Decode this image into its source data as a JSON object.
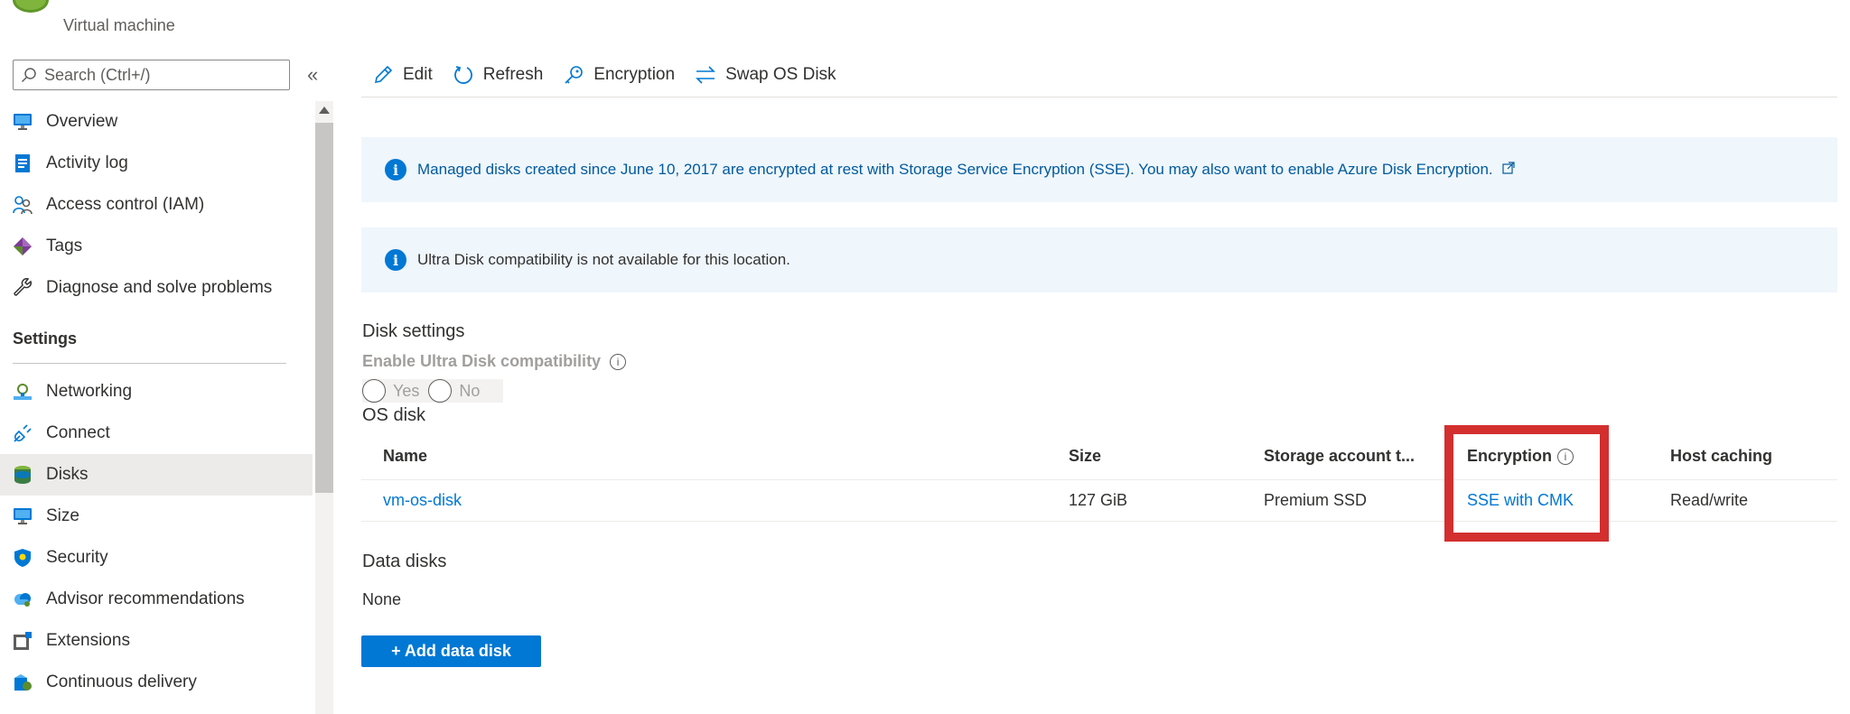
{
  "header": {
    "subtitle": "Virtual machine"
  },
  "search": {
    "placeholder": "Search (Ctrl+/)"
  },
  "sidebar": {
    "collapse_label": "«",
    "items_top": [
      {
        "label": "Overview",
        "icon": "monitor-icon"
      },
      {
        "label": "Activity log",
        "icon": "activity-log-icon"
      },
      {
        "label": "Access control (IAM)",
        "icon": "people-icon"
      },
      {
        "label": "Tags",
        "icon": "tag-icon"
      },
      {
        "label": "Diagnose and solve problems",
        "icon": "wrench-icon"
      }
    ],
    "settings_heading": "Settings",
    "items_settings": [
      {
        "label": "Networking",
        "icon": "network-icon"
      },
      {
        "label": "Connect",
        "icon": "connect-plug-icon"
      },
      {
        "label": "Disks",
        "icon": "disks-icon",
        "active": true
      },
      {
        "label": "Size",
        "icon": "monitor-icon"
      },
      {
        "label": "Security",
        "icon": "shield-icon"
      },
      {
        "label": "Advisor recommendations",
        "icon": "advisor-cloud-icon"
      },
      {
        "label": "Extensions",
        "icon": "extensions-icon"
      },
      {
        "label": "Continuous delivery",
        "icon": "delivery-icon"
      }
    ]
  },
  "toolbar": {
    "edit_label": "Edit",
    "refresh_label": "Refresh",
    "encryption_label": "Encryption",
    "swap_label": "Swap OS Disk"
  },
  "info": {
    "sse_text": "Managed disks created since June 10, 2017 are encrypted at rest with Storage Service Encryption (SSE). You may also want to enable Azure Disk Encryption.",
    "ultra_text": "Ultra Disk compatibility is not available for this location."
  },
  "disk_settings": {
    "title": "Disk settings",
    "ultra_label": "Enable Ultra Disk compatibility",
    "yes_label": "Yes",
    "no_label": "No"
  },
  "os_disk": {
    "title": "OS disk",
    "columns": [
      "Name",
      "Size",
      "Storage account t...",
      "Encryption",
      "Host caching"
    ],
    "row": {
      "name": "vm-os-disk",
      "size": "127 GiB",
      "storage": "Premium SSD",
      "encryption": "SSE with CMK",
      "caching": "Read/write"
    }
  },
  "data_disks": {
    "title": "Data disks",
    "none_text": "None",
    "add_button": "+ Add data disk"
  },
  "colors": {
    "accent": "#0078d4",
    "highlight": "#d32f2f",
    "info_bg": "#eff6fc",
    "active_bg": "#edebe9"
  }
}
